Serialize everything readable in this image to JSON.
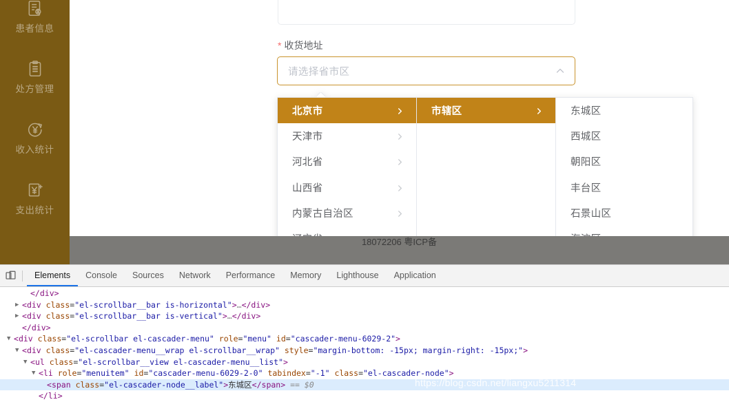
{
  "sidebar": {
    "bg_color": "#7a5a14",
    "items": [
      {
        "label": "患者信息",
        "icon": "patient-record-icon"
      },
      {
        "label": "处方管理",
        "icon": "clipboard-icon"
      },
      {
        "label": "收入统计",
        "icon": "income-yen-icon"
      },
      {
        "label": "支出统计",
        "icon": "expense-yen-icon"
      },
      {
        "label": "",
        "icon": "document-edit-icon"
      }
    ]
  },
  "form": {
    "label": "收货地址",
    "required_marker": "*",
    "cascader": {
      "placeholder": "请选择省市区",
      "caret": "chevron-up-icon",
      "border_color": "#c9932c"
    }
  },
  "cascader_menus": {
    "active_color": "#c18318",
    "columns": [
      {
        "id": "cascader-menu-6029-0",
        "items": [
          {
            "label": "北京市",
            "active": true,
            "has_children": true
          },
          {
            "label": "天津市",
            "active": false,
            "has_children": true
          },
          {
            "label": "河北省",
            "active": false,
            "has_children": true
          },
          {
            "label": "山西省",
            "active": false,
            "has_children": true
          },
          {
            "label": "内蒙古自治区",
            "active": false,
            "has_children": true
          },
          {
            "label": "辽宁省",
            "active": false,
            "has_children": true
          }
        ]
      },
      {
        "id": "cascader-menu-6029-1",
        "items": [
          {
            "label": "市辖区",
            "active": true,
            "has_children": true
          }
        ]
      },
      {
        "id": "cascader-menu-6029-2",
        "items": [
          {
            "label": "东城区",
            "active": false,
            "has_children": false
          },
          {
            "label": "西城区",
            "active": false,
            "has_children": false
          },
          {
            "label": "朝阳区",
            "active": false,
            "has_children": false
          },
          {
            "label": "丰台区",
            "active": false,
            "has_children": false
          },
          {
            "label": "石景山区",
            "active": false,
            "has_children": false
          },
          {
            "label": "海淀区",
            "active": false,
            "has_children": false
          }
        ]
      }
    ]
  },
  "footer": {
    "icp": "18072206 粤ICP备"
  },
  "devtools": {
    "device_toolbar_icon": "device-toolbar-icon",
    "tabs": [
      {
        "label": "Elements",
        "selected": true
      },
      {
        "label": "Console",
        "selected": false
      },
      {
        "label": "Sources",
        "selected": false
      },
      {
        "label": "Network",
        "selected": false
      },
      {
        "label": "Performance",
        "selected": false
      },
      {
        "label": "Memory",
        "selected": false
      },
      {
        "label": "Lighthouse",
        "selected": false
      },
      {
        "label": "Application",
        "selected": false
      }
    ],
    "dom_lines": [
      {
        "indent": 3,
        "twisty": "",
        "html": "<span class=\"punc\">&lt;/div&gt;</span>"
      },
      {
        "indent": 2,
        "twisty": "▶",
        "html": "<span class=\"punc\">&lt;</span><span class=\"tag\">div</span> <span class=\"attr\">class</span>=<span class=\"val\">\"el-scrollbar__bar is-horizontal\"</span><span class=\"punc\">&gt;</span><span class=\"ellip\">…</span><span class=\"punc\">&lt;/div&gt;</span>"
      },
      {
        "indent": 2,
        "twisty": "▶",
        "html": "<span class=\"punc\">&lt;</span><span class=\"tag\">div</span> <span class=\"attr\">class</span>=<span class=\"val\">\"el-scrollbar__bar is-vertical\"</span><span class=\"punc\">&gt;</span><span class=\"ellip\">…</span><span class=\"punc\">&lt;/div&gt;</span>"
      },
      {
        "indent": 2,
        "twisty": "",
        "html": "<span class=\"punc\">&lt;/div&gt;</span>"
      },
      {
        "indent": 1,
        "twisty": "▼",
        "html": "<span class=\"punc\">&lt;</span><span class=\"tag\">div</span> <span class=\"attr\">class</span>=<span class=\"val\">\"el-scrollbar el-cascader-menu\"</span> <span class=\"attr\">role</span>=<span class=\"val\">\"menu\"</span> <span class=\"attr\">id</span>=<span class=\"val\">\"cascader-menu-6029-2\"</span><span class=\"punc\">&gt;</span>"
      },
      {
        "indent": 2,
        "twisty": "▼",
        "html": "<span class=\"punc\">&lt;</span><span class=\"tag\">div</span> <span class=\"attr\">class</span>=<span class=\"val\">\"el-cascader-menu__wrap el-scrollbar__wrap\"</span> <span class=\"attr\">style</span>=<span class=\"val\">\"margin-bottom: -15px; margin-right: -15px;\"</span><span class=\"punc\">&gt;</span>"
      },
      {
        "indent": 3,
        "twisty": "▼",
        "html": "<span class=\"punc\">&lt;</span><span class=\"tag\">ul</span> <span class=\"attr\">class</span>=<span class=\"val\">\"el-scrollbar__view el-cascader-menu__list\"</span><span class=\"punc\">&gt;</span>"
      },
      {
        "indent": 4,
        "twisty": "▼",
        "html": "<span class=\"punc\">&lt;</span><span class=\"tag\">li</span> <span class=\"attr\">role</span>=<span class=\"val\">\"menuitem\"</span> <span class=\"attr\">id</span>=<span class=\"val\">\"cascader-menu-6029-2-0\"</span> <span class=\"attr\">tabindex</span>=<span class=\"val\">\"-1\"</span> <span class=\"attr\">class</span>=<span class=\"val\">\"el-cascader-node\"</span><span class=\"punc\">&gt;</span>"
      },
      {
        "indent": 5,
        "twisty": "",
        "hl": true,
        "html": "<span class=\"punc\">&lt;</span><span class=\"tag\">span</span> <span class=\"attr\">class</span>=<span class=\"val\">\"el-cascader-node__label\"</span><span class=\"punc\">&gt;</span><span class=\"txt\">东城区</span><span class=\"punc\">&lt;/span&gt;</span> <span class=\"dollar\">== $0</span>"
      },
      {
        "indent": 4,
        "twisty": "",
        "html": "<span class=\"punc\">&lt;/li&gt;</span>"
      }
    ]
  },
  "watermark": {
    "text": "https://blog.csdn.net/liangxu5211314"
  }
}
